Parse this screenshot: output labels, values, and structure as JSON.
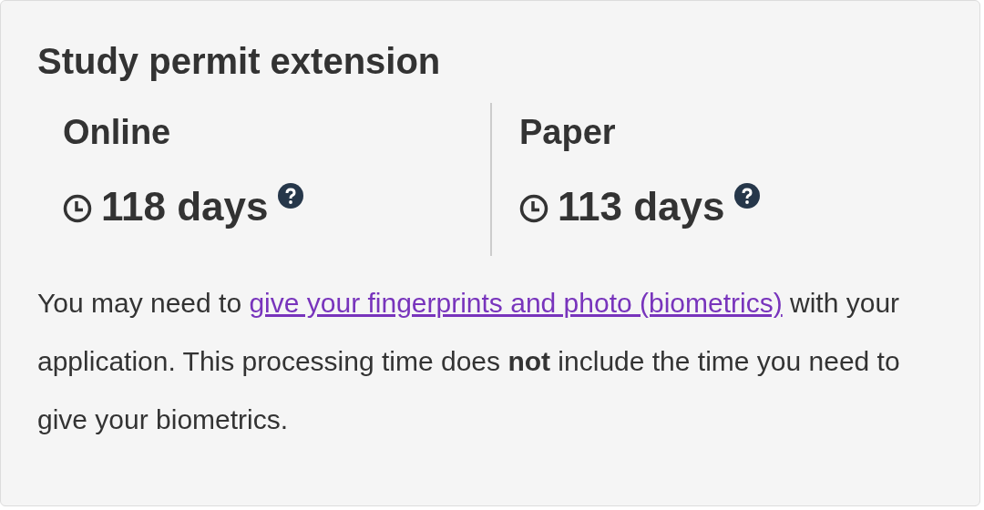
{
  "title": "Study permit extension",
  "options": [
    {
      "label": "Online",
      "time": "118 days"
    },
    {
      "label": "Paper",
      "time": "113 days"
    }
  ],
  "note": {
    "before": "You may need to ",
    "link": "give your fingerprints and photo (biometrics)",
    "after": " with your application. This processing time does **not** include the time you need to give your biometrics."
  }
}
